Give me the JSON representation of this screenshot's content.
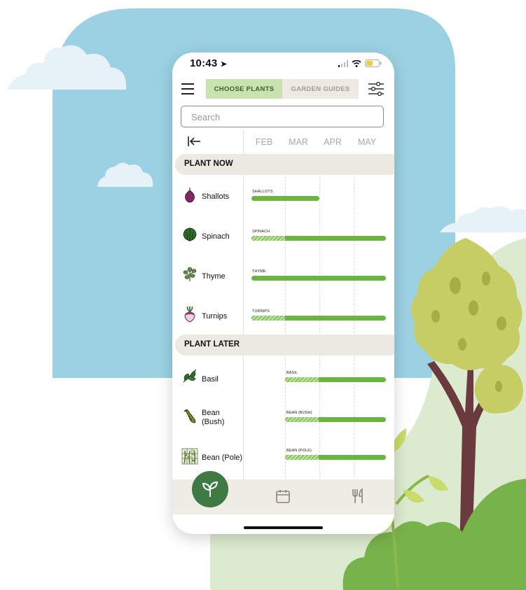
{
  "status_bar": {
    "time": "10:43"
  },
  "tabs": {
    "choose_plants": "CHOOSE PLANTS",
    "garden_guides": "GARDEN GUIDES"
  },
  "search": {
    "placeholder": "Search"
  },
  "timeline": {
    "months": [
      "FEB",
      "MAR",
      "APR",
      "MAY"
    ]
  },
  "sections": {
    "plant_now": {
      "title": "PLANT NOW",
      "plants": [
        {
          "name": "Shallots",
          "bar_label": "SHALLOTS",
          "icon": "shallot-icon"
        },
        {
          "name": "Spinach",
          "bar_label": "SPINACH",
          "icon": "spinach-icon"
        },
        {
          "name": "Thyme",
          "bar_label": "THYME",
          "icon": "thyme-icon"
        },
        {
          "name": "Turnips",
          "bar_label": "TURNIPS",
          "icon": "turnip-icon"
        }
      ]
    },
    "plant_later": {
      "title": "PLANT LATER",
      "plants": [
        {
          "name": "Basil",
          "bar_label": "BASIL",
          "icon": "basil-icon"
        },
        {
          "name": "Bean (Bush)",
          "bar_label": "BEAN (BUSH)",
          "icon": "bean-bush-icon"
        },
        {
          "name": "Bean (Pole)",
          "bar_label": "BEAN (POLE)",
          "icon": "bean-pole-icon"
        }
      ]
    }
  },
  "bottom_nav": {
    "items": [
      "seedling-icon",
      "calendar-icon",
      "fork-knife-icon"
    ]
  },
  "colors": {
    "sky": "#9bd1e3",
    "cloud": "#e6f1f8",
    "accent_green": "#6ab542",
    "tab_active": "#c9e3b0",
    "nav_active": "#3f7a45"
  }
}
